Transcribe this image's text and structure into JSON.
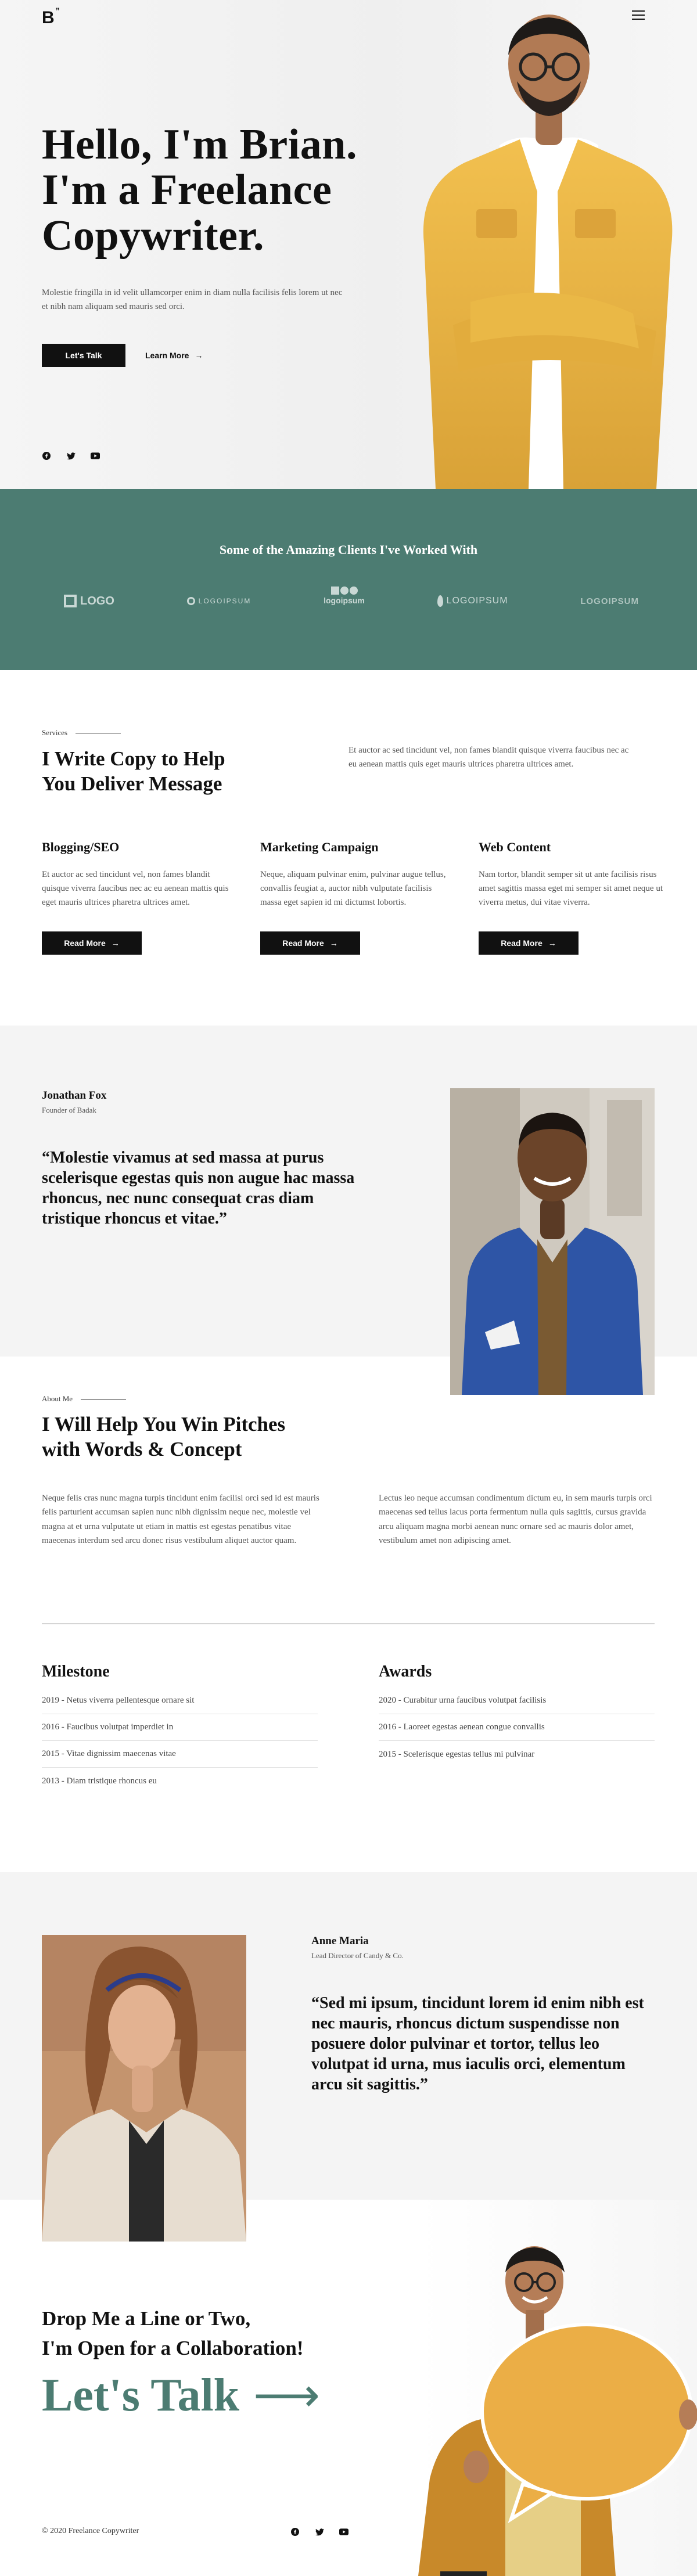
{
  "header": {
    "logo": "B",
    "logo_mark": "”"
  },
  "hero": {
    "title_line1": "Hello, I'm Brian.",
    "title_line2": "I'm a Freelance",
    "title_line3": "Copywriter.",
    "description": "Molestie fringilla in id velit ullamcorper enim in diam nulla facilisis felis lorem ut nec et nibh nam aliquam sed mauris sed orci.",
    "primary_btn": "Let's Talk",
    "secondary_btn": "Learn More",
    "arrow": "→"
  },
  "clients": {
    "title": "Some of the Amazing Clients I've Worked With",
    "logos": [
      "LOGO",
      "LOGOIPSUM",
      "logoipsum",
      "LOGOIPSUM",
      "LOGOIPSUM"
    ]
  },
  "services": {
    "label": "Services",
    "title_line1": "I Write Copy to Help",
    "title_line2": "You Deliver Message",
    "intro": "Et auctor ac sed tincidunt vel, non fames blandit quisque viverra faucibus nec ac eu aenean mattis quis eget mauris ultrices pharetra ultrices amet.",
    "items": [
      {
        "title": "Blogging/SEO",
        "text": "Et auctor ac sed tincidunt vel, non fames blandit quisque viverra faucibus nec ac eu aenean mattis quis eget mauris ultrices pharetra ultrices amet.",
        "btn": "Read More"
      },
      {
        "title": "Marketing Campaign",
        "text": "Neque, aliquam pulvinar enim, pulvinar augue tellus, convallis feugiat a, auctor nibh vulputate facilisis massa eget sapien id mi dictumst lobortis.",
        "btn": "Read More"
      },
      {
        "title": "Web Content",
        "text": "Nam tortor, blandit semper sit ut ante facilisis risus amet sagittis massa eget mi semper sit amet neque ut viverra metus, dui vitae viverra.",
        "btn": "Read More"
      }
    ]
  },
  "testimonial1": {
    "name": "Jonathan Fox",
    "role": "Founder of Badak",
    "quote": "“Molestie vivamus at sed massa at purus scelerisque egestas quis non augue hac massa rhoncus, nec nunc consequat cras diam tristique rhoncus et vitae.”"
  },
  "about": {
    "label": "About Me",
    "title_line1": "I Will Help You Win Pitches",
    "title_line2": "with Words & Concept",
    "col1": "Neque felis cras nunc magna turpis tincidunt enim facilisi orci sed id est mauris felis parturient accumsan sapien nunc nibh dignissim neque nec, molestie vel magna at et urna vulputate ut etiam in mattis est egestas penatibus vitae maecenas interdum sed arcu donec risus vestibulum aliquet auctor quam.",
    "col2": "Lectus leo neque accumsan condimentum dictum eu, in sem mauris turpis orci maecenas sed tellus lacus porta fermentum nulla quis sagittis, cursus gravida arcu aliquam magna morbi aenean nunc ornare sed ac mauris dolor amet, vestibulum amet non adipiscing amet.",
    "milestone_title": "Milestone",
    "awards_title": "Awards",
    "milestones": [
      "2019 - Netus viverra pellentesque ornare sit",
      "2016 - Faucibus volutpat imperdiet in",
      "2015 - Vitae dignissim maecenas vitae",
      "2013 - Diam tristique rhoncus eu"
    ],
    "awards": [
      "2020 - Curabitur urna faucibus volutpat facilisis",
      "2016 - Laoreet egestas aenean congue convallis",
      "2015 - Scelerisque egestas tellus mi pulvinar"
    ]
  },
  "testimonial2": {
    "name": "Anne Maria",
    "role": "Lead Director of Candy & Co.",
    "quote": "“Sed mi ipsum, tincidunt lorem id enim nibh est nec mauris, rhoncus dictum suspendisse non posuere dolor pulvinar et tortor, tellus leo volutpat id urna, mus iaculis orci, elementum arcu sit sagittis.”"
  },
  "contact": {
    "line1": "Drop Me a Line or Two,",
    "line2": "I'm Open for a Collaboration!",
    "cta": "Let's Talk",
    "cta_arrow": "⟶",
    "copyright": "© 2020 Freelance Copywriter"
  },
  "colors": {
    "accent": "#4c7c72",
    "dark": "#111111",
    "yellow": "#e8b44a"
  }
}
